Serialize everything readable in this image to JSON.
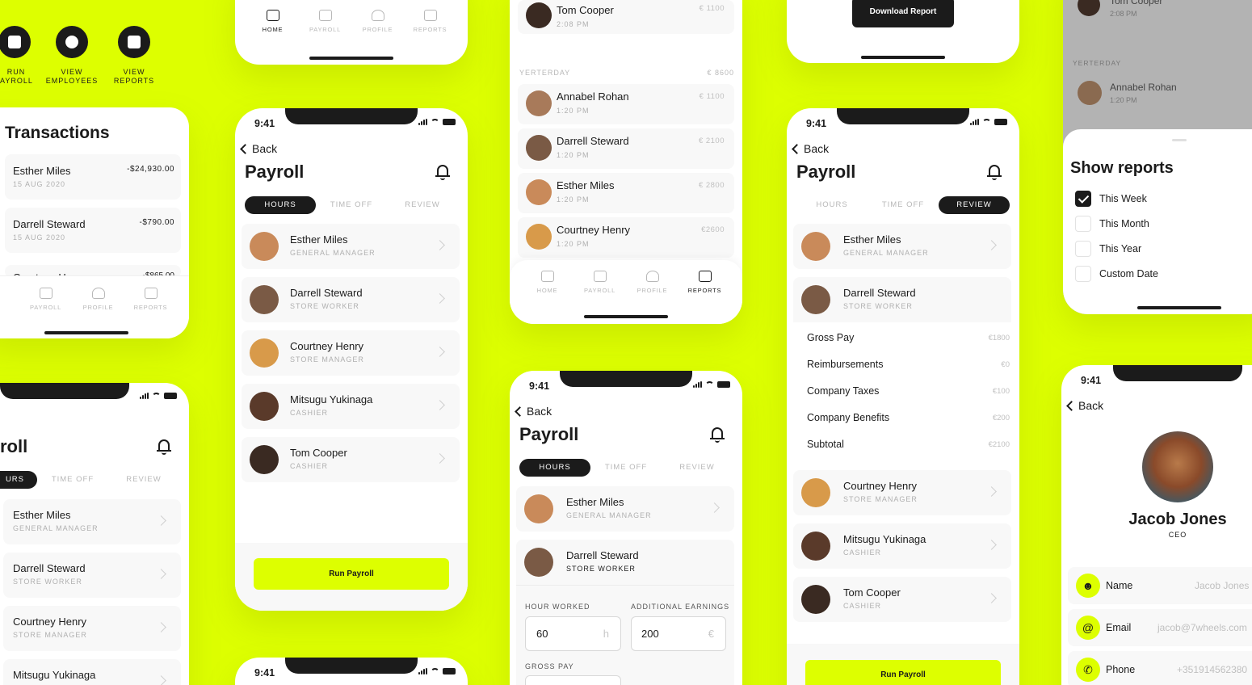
{
  "status_time": "9:41",
  "back_label": "Back",
  "payroll_title": "Payroll",
  "tabs": {
    "hours": "HOURS",
    "timeoff": "TIME OFF",
    "review": "REVIEW"
  },
  "nav": {
    "home": "HOME",
    "payroll": "PAYROLL",
    "profile": "PROFILE",
    "reports": "REPORTS"
  },
  "run_payroll": "Run Payroll",
  "download_report": "Download Report",
  "quick_actions": {
    "run_line1": "RUN",
    "run_line2": "AYROLL",
    "emp_line1": "VIEW",
    "emp_line2": "EMPLOYEES",
    "rep_line1": "VIEW",
    "rep_line2": "REPORTS"
  },
  "transactions": {
    "title": "Transactions",
    "items": [
      {
        "name": "Esther Miles",
        "date": "15 AUG 2020",
        "amount": "-$24,930.00"
      },
      {
        "name": "Darrell Steward",
        "date": "15 AUG 2020",
        "amount": "-$790.00"
      },
      {
        "name": "Courtney Henry",
        "amount": "-$865.00"
      }
    ]
  },
  "partial_title": "roll",
  "partial_hours": "URS",
  "employees": [
    {
      "name": "Esther Miles",
      "role": "GENERAL MANAGER"
    },
    {
      "name": "Darrell Steward",
      "role": "STORE WORKER"
    },
    {
      "name": "Courtney Henry",
      "role": "STORE MANAGER"
    },
    {
      "name": "Mitsugu Yukinaga",
      "role": "CASHIER"
    },
    {
      "name": "Tom Cooper",
      "role": "CASHIER"
    }
  ],
  "mid_top": {
    "name": "Tom Cooper",
    "time": "2:08 PM",
    "amount": "€ 1100"
  },
  "yesterday": {
    "label": "YERTERDAY",
    "total": "€ 8600",
    "items": [
      {
        "name": "Annabel Rohan",
        "time": "1:20 PM",
        "amount": "€ 1100"
      },
      {
        "name": "Darrell Steward",
        "time": "1:20 PM",
        "amount": "€ 2100"
      },
      {
        "name": "Esther Miles",
        "time": "1:20 PM",
        "amount": "€ 2800"
      },
      {
        "name": "Courtney Henry",
        "time": "1:20 PM",
        "amount": "€2600"
      }
    ]
  },
  "hours_form": {
    "hour_worked_label": "HOUR WORKED",
    "hour_worked_value": "60",
    "hour_unit": "h",
    "additional_label": "ADDITIONAL EARNINGS",
    "additional_value": "200",
    "additional_unit": "€",
    "gross_pay_label": "GROSS PAY",
    "expanded_role": "STORE WORKER"
  },
  "breakdown": [
    {
      "label": "Gross Pay",
      "value": "€1800"
    },
    {
      "label": "Reimbursements",
      "value": "€0"
    },
    {
      "label": "Company Taxes",
      "value": "€100"
    },
    {
      "label": "Company Benefits",
      "value": "€200"
    },
    {
      "label": "Subtotal",
      "value": "€2100"
    }
  ],
  "reports_sheet": {
    "title": "Show reports",
    "options": [
      {
        "label": "This Week",
        "checked": true
      },
      {
        "label": "This Month",
        "checked": false
      },
      {
        "label": "This Year",
        "checked": false
      },
      {
        "label": "Custom Date",
        "checked": false
      }
    ]
  },
  "dim_list": {
    "top_name": "Tom Cooper",
    "top_time": "2:08 PM",
    "yesterday": "YERTERDAY",
    "name": "Annabel Rohan",
    "time": "1:20 PM"
  },
  "profile": {
    "name": "Jacob Jones",
    "title": "CEO",
    "fields": [
      {
        "label": "Name",
        "value": "Jacob Jones"
      },
      {
        "label": "Email",
        "value": "jacob@7wheels.com"
      },
      {
        "label": "Phone",
        "value": "+351914562380"
      }
    ]
  },
  "colors": {
    "accent": "#DDFF00",
    "dark": "#1b1b1b",
    "muted": "#b8b8b8"
  }
}
